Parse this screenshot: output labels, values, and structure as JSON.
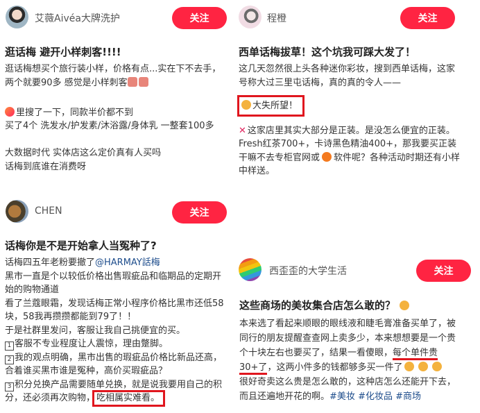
{
  "follow_label": "关注",
  "accent_color": "#ff2442",
  "posts": [
    {
      "username": "艾薇Aivéa大牌洗护",
      "title": "逛话梅 避开小样刺客!!!!",
      "lines": [
        "逛话梅想买个旅行装小样，价格有点...实在下不去手，",
        "两个就要90多 感觉是小样刺客",
        "",
        "里搜了一下，同款半价都不到",
        "买了4个 洗发水/护发素/沐浴露/身体乳 一整套100多",
        "",
        "大数据时代 实体店这么定价真有人买吗",
        "话梅到底谁在消费呀"
      ],
      "emoji_names": [
        "pig-face-icon",
        "pig-face-icon",
        "app-logo-icon"
      ]
    },
    {
      "username": "程橙",
      "title": "西单话梅拔草！这个坑我可踩大发了！",
      "lines": [
        "这几天忽然很上头各种迷你彩妆，搜到西单话梅，这家",
        "号称大过三里屯话梅，真的真的令人——",
        "",
        "大失所望！",
        "",
        "这家店里其实大部分是正装。是没怎么便宜的正装。",
        "Fresh红茶700+，卡诗黑色精油400+，那我要买正装",
        "干嘛不去专柜官网或",
        "软件呢？各种活动时期还有小样",
        "中样送。"
      ]
    },
    {
      "username": "CHEN",
      "title": "话梅你是不是开始拿人当冤种了?",
      "lines": [
        "话梅四五年老粉要撤了",
        "@HARMAY話梅",
        "黑市一直是个以较低价格出售瑕疵品和临期品的定期开",
        "始的购物通道",
        "看了兰蔻眼霜，发现话梅正常小程序价格比黑市还低58",
        "块，58我再攒攒都能到79了！！",
        "于是社群里发问，客服让我自己挑便宜的买。",
        "客服不专业程度让人震惊，理由蹩脚。",
        "我的观点明确，黑市出售的瑕疵品价格比新品还高，",
        "合着谁买黑市谁是冤种，高价买瑕疵品？",
        "积分兑换产品需要随单兑换，就是说我要用自己的积",
        "分，还必须再次购物，",
        "吃相属实难看。"
      ],
      "list_numbers": [
        "1",
        "2",
        "3"
      ]
    },
    {
      "username": "西歪歪的大学生活",
      "title": "这些商场的美妆集合店怎么敢的？",
      "lines": [
        "本来选了看起来顺眼的眼线液和睫毛膏准备买单了，被",
        "同行的朋友提醒查查网上卖多少，本来想想要是一个贵",
        "个十块左右也要买了，结果一看傻眼，",
        "每个单件贵",
        "30+了",
        "，这两小件多的钱都够多买一件了",
        "很好奇卖这么贵是怎么敢的，这种店怎么还能开下去，",
        "而且还遍地开花的啊。"
      ],
      "hashtags": [
        "#美妆",
        "#化妆品",
        "#商场"
      ]
    }
  ]
}
